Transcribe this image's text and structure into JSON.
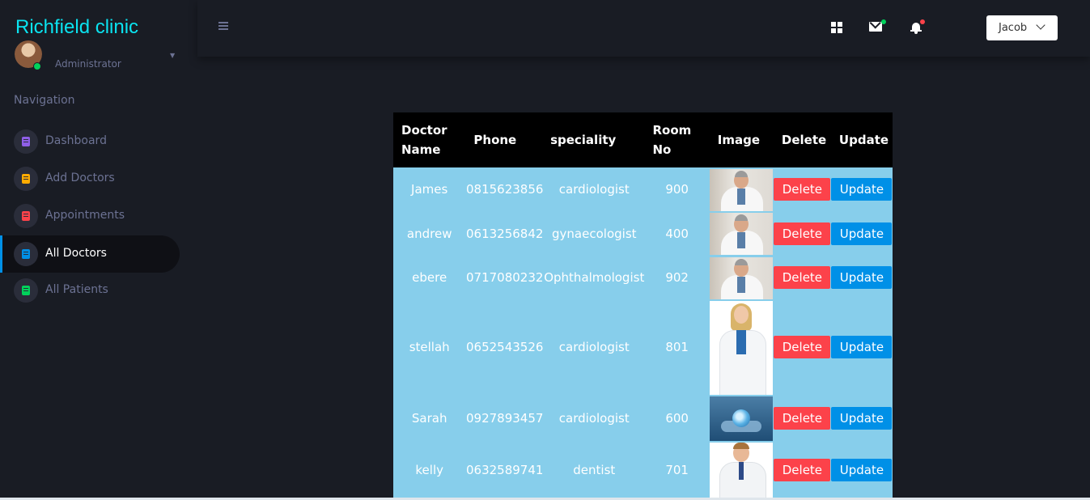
{
  "brand": "Richfield clinic",
  "profile": {
    "role": "Administrator"
  },
  "navigation": {
    "heading": "Navigation",
    "items": [
      {
        "label": "Dashboard",
        "icon": "document-icon",
        "color": "#8f5fe8"
      },
      {
        "label": "Add Doctors",
        "icon": "document-icon",
        "color": "#ffab00"
      },
      {
        "label": "Appointments",
        "icon": "document-icon",
        "color": "#fc424a"
      },
      {
        "label": "All Doctors",
        "icon": "document-icon",
        "color": "#0090e7",
        "active": true
      },
      {
        "label": "All Patients",
        "icon": "document-icon",
        "color": "#00d25b"
      }
    ]
  },
  "topbar": {
    "user": "Jacob",
    "icons": [
      "menu-toggle-icon",
      "grid-icon",
      "mail-icon",
      "bell-icon"
    ]
  },
  "table": {
    "headers": [
      "Doctor Name",
      "Phone",
      "speciality",
      "Room No",
      "Image",
      "Delete",
      "Update"
    ],
    "rows": [
      {
        "name": "James",
        "phone": "0815623856",
        "speciality": "cardiologist",
        "room": "900",
        "photo": "doctor-man-photo",
        "delete": "Delete",
        "update": "Update"
      },
      {
        "name": "andrew",
        "phone": "0613256842",
        "speciality": "gynaecologist",
        "room": "400",
        "photo": "doctor-man-photo",
        "delete": "Delete",
        "update": "Update"
      },
      {
        "name": "ebere",
        "phone": "0717080232",
        "speciality": "Ophthalmologist",
        "room": "902",
        "photo": "doctor-man-photo",
        "delete": "Delete",
        "update": "Update"
      },
      {
        "name": "stellah",
        "phone": "0652543526",
        "speciality": "cardiologist",
        "room": "801",
        "photo": "doctor-woman-photo",
        "delete": "Delete",
        "update": "Update"
      },
      {
        "name": "Sarah",
        "phone": "0927893457",
        "speciality": "cardiologist",
        "room": "600",
        "photo": "globe-hands-photo",
        "delete": "Delete",
        "update": "Update"
      },
      {
        "name": "kelly",
        "phone": "0632589741",
        "speciality": "dentist",
        "room": "701",
        "photo": "doctor-man-tie-photo",
        "delete": "Delete",
        "update": "Update"
      }
    ]
  },
  "colors": {
    "brand": "#0ae3f0",
    "background": "#191c24",
    "table_body": "#87ceeb",
    "table_header": "#000000",
    "delete_button": "#fc424a",
    "update_button": "#0090e7"
  }
}
